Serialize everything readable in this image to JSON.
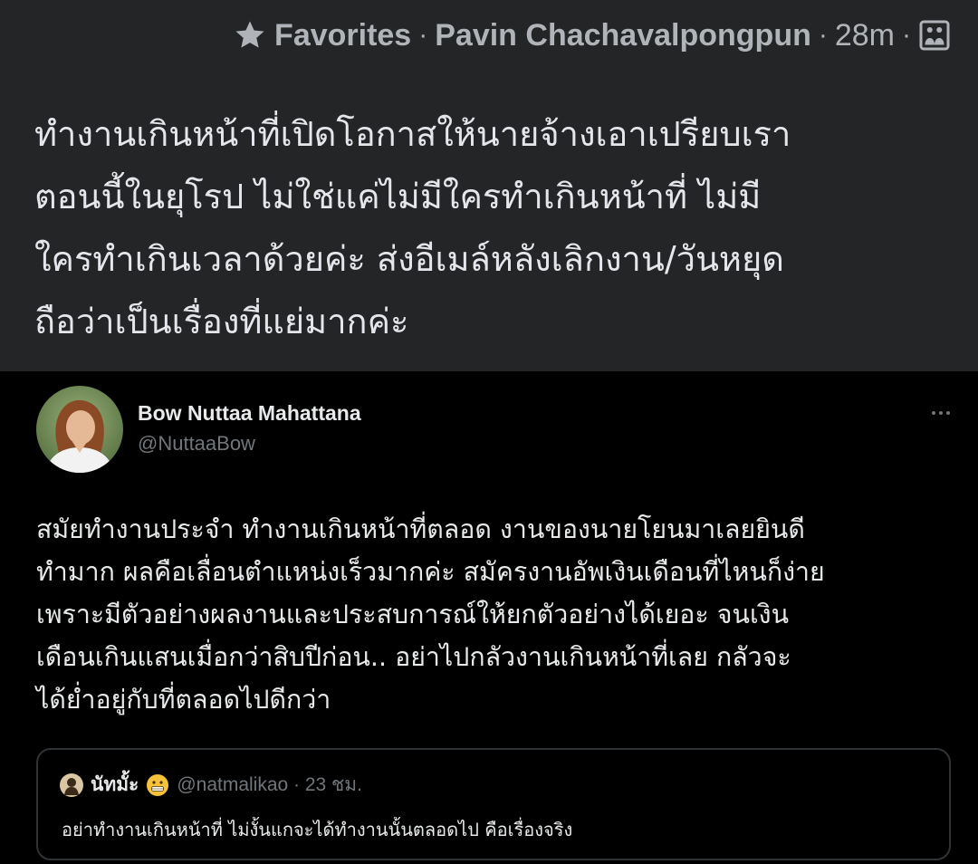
{
  "post": {
    "favorites_label": "Favorites",
    "author": "Pavin Chachavalpongpun",
    "time": "28m",
    "separator": "·",
    "text": "ทำงานเกินหน้าที่เปิดโอกาสให้นายจ้างเอาเปรียบเรา\nตอนนี้ในยุโรป ไม่ใช่แค่ไม่มีใครทำเกินหน้าที่ ไม่มี\nใครทำเกินเวลาด้วยค่ะ ส่งอีเมล์หลังเลิกงาน/วันหยุด\nถือว่าเป็นเรื่องที่แย่มากค่ะ",
    "icons": [
      "star-icon",
      "image-icon"
    ]
  },
  "tweet": {
    "display_name": "Bow Nuttaa Mahattana",
    "handle": "@NuttaaBow",
    "more_label": "···",
    "text": "สมัยทำงานประจำ ทำงานเกินหน้าที่ตลอด งานของนายโยนมาเลยยินดี\nทำมาก ผลคือเลื่อนตำแหน่งเร็วมากค่ะ สมัครงานอัพเงินเดือนที่ไหนก็ง่าย\nเพราะมีตัวอย่างผลงานและประสบการณ์ให้ยกตัวอย่างได้เยอะ จนเงิน\nเดือนเกินแสนเมื่อกว่าสิบปีก่อน.. อย่าไปกลัวงานเกินหน้าที่เลย กลัวจะ\nได้ย่ำอยู่กับที่ตลอดไปดีกว่า",
    "quote": {
      "name": "นัทมั้ะ",
      "handle_time": "@natmalikao · 23 ชม.",
      "text": "อย่าทำงานเกินหน้าที่ ไม่งั้นแกจะได้ทำงานนั้นตลอดไป คือเรื่องจริง"
    }
  },
  "colors": {
    "post_bg": "#242526",
    "tweet_bg": "#000000",
    "muted": "#b0b3b8",
    "tweet_muted": "#71767b",
    "border": "#2f3336"
  }
}
